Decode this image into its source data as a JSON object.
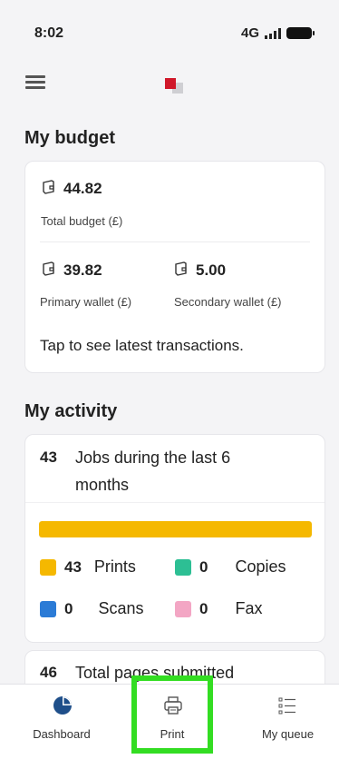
{
  "status_bar": {
    "time": "8:02",
    "network": "4G"
  },
  "budget": {
    "title": "My budget",
    "total_amount": "44.82",
    "total_label": "Total budget (£)",
    "primary_amount": "39.82",
    "primary_label": "Primary wallet (£)",
    "secondary_amount": "5.00",
    "secondary_label": "Secondary wallet (£)",
    "transactions_link": "Tap to see latest transactions."
  },
  "activity": {
    "title": "My activity",
    "jobs_count": "43",
    "jobs_label_line1": "Jobs during the last 6",
    "jobs_label_line2": "months",
    "progress_fraction": 1.0,
    "legend": [
      {
        "count": "43",
        "label": "Prints",
        "color": "#f5b800"
      },
      {
        "count": "0",
        "label": "Copies",
        "color": "#2dbf94"
      },
      {
        "count": "0",
        "label": "Scans",
        "color": "#2b7bd6"
      },
      {
        "count": "0",
        "label": "Fax",
        "color": "#f3a6c4"
      }
    ],
    "pages_count": "46",
    "pages_label": "Total pages submitted"
  },
  "nav": {
    "items": [
      {
        "label": "Dashboard",
        "icon": "pie-chart-icon"
      },
      {
        "label": "Print",
        "icon": "printer-icon"
      },
      {
        "label": "My queue",
        "icon": "list-icon"
      }
    ]
  },
  "colors": {
    "accent": "#f5b800",
    "highlight": "#33dd22",
    "logo": "#d0182a"
  }
}
